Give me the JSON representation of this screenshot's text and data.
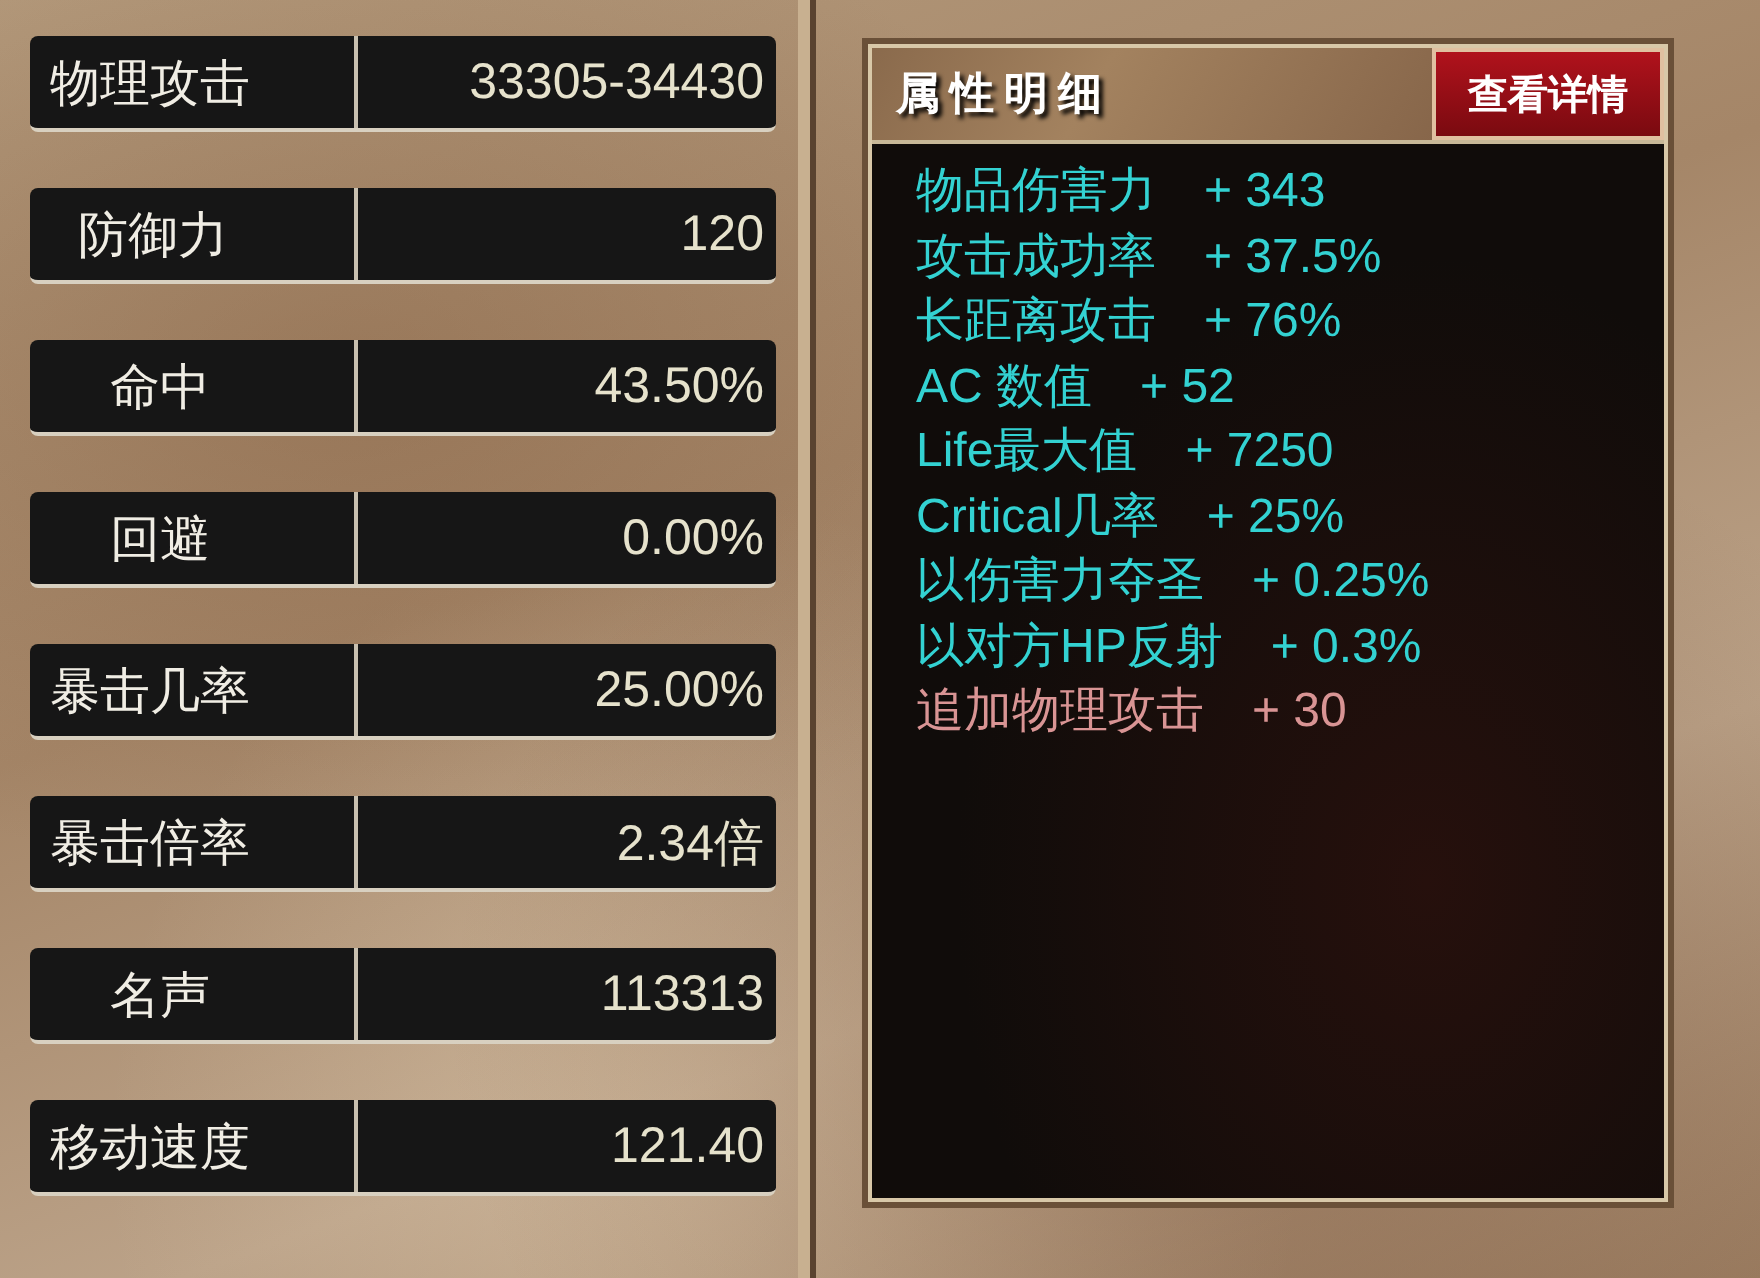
{
  "stats": [
    {
      "label": "物理攻击",
      "value": "33305-34430"
    },
    {
      "label": "防御力",
      "value": "120"
    },
    {
      "label": "命中",
      "value": "43.50%"
    },
    {
      "label": "回避",
      "value": "0.00%"
    },
    {
      "label": "暴击几率",
      "value": "25.00%"
    },
    {
      "label": "暴击倍率",
      "value": "2.34倍"
    },
    {
      "label": "名声",
      "value": "113313"
    },
    {
      "label": "移动速度",
      "value": "121.40"
    }
  ],
  "details": {
    "title": "属性明细",
    "button": "查看详情",
    "attributes": [
      {
        "name": "物品伤害力",
        "value": "+ 343",
        "color": "#33d2d2"
      },
      {
        "name": "攻击成功率",
        "value": "+ 37.5%",
        "color": "#33d2d2"
      },
      {
        "name": "长距离攻击",
        "value": "+ 76%",
        "color": "#33d2d2"
      },
      {
        "name": "AC 数值",
        "value": "+ 52",
        "color": "#33d2d2"
      },
      {
        "name": "Life最大值",
        "value": "+ 7250",
        "color": "#33d2d2"
      },
      {
        "name": "Critical几率",
        "value": "+ 25%",
        "color": "#33d2d2"
      },
      {
        "name": "以伤害力夺圣",
        "value": "+ 0.25%",
        "color": "#33d2d2"
      },
      {
        "name": "以对方HP反射",
        "value": "+ 0.3%",
        "color": "#33d2d2"
      },
      {
        "name": "追加物理攻击",
        "value": "+ 30",
        "color": "#d99494"
      }
    ]
  }
}
